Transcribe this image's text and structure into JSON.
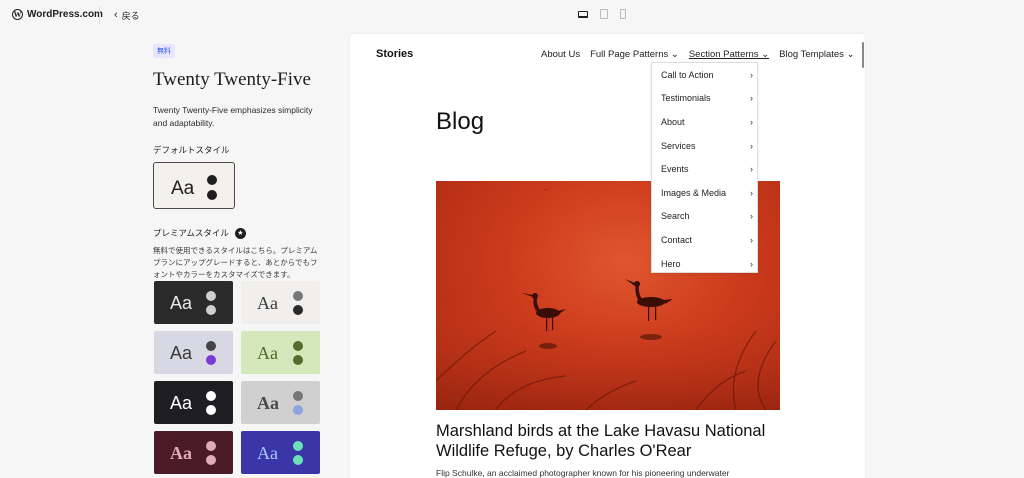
{
  "topbar": {
    "brand": "WordPress.com",
    "back_label": "戻る"
  },
  "sidebar": {
    "badge": "無料",
    "theme_title": "Twenty Twenty-Five",
    "theme_description": "Twenty Twenty-Five emphasizes simplicity and adaptability.",
    "default_style_label": "デフォルトスタイル",
    "default_style": {
      "sample": "Aa",
      "bg": "#f4f1ec",
      "fg": "#1e1e1e",
      "dot1": "#1e1e1e",
      "dot2": "#1e1e1e"
    },
    "premium_label": "プレミアムスタイル",
    "premium_description": "無料で使用できるスタイルはこちら。プレミアムプランにアップグレードすると、あとからでもフォントやカラーをカスタマイズできます。",
    "styles": [
      {
        "sample": "Aa",
        "bg": "#2a2a2a",
        "fg": "#e8e8e8",
        "dot1": "#d0d0d0",
        "dot2": "#d0d0d0",
        "font": "sans"
      },
      {
        "sample": "Aa",
        "bg": "#f0efee",
        "fg": "#3a3a3a",
        "dot1": "#777777",
        "dot2": "#2a2a2a",
        "font": "serif"
      },
      {
        "sample": "Aa",
        "bg": "#d8d8e4",
        "fg": "#3a3a3a",
        "dot1": "#444444",
        "dot2": "#7a3ad8",
        "font": "sans"
      },
      {
        "sample": "Aa",
        "bg": "#d4e8bc",
        "fg": "#4a6a26",
        "dot1": "#556b2f",
        "dot2": "#556b2f",
        "font": "serif"
      },
      {
        "sample": "Aa",
        "bg": "#1e1e22",
        "fg": "#ffffff",
        "dot1": "#ffffff",
        "dot2": "#ffffff",
        "font": "sans"
      },
      {
        "sample": "Aa",
        "bg": "#d0d0d0",
        "fg": "#4a4a4a",
        "dot1": "#777777",
        "dot2": "#8fa4e0",
        "font": "serif-bold"
      },
      {
        "sample": "Aa",
        "bg": "#4a1a26",
        "fg": "#e2a9b6",
        "dot1": "#e2a9b6",
        "dot2": "#e2a9b6",
        "font": "serif-bold"
      },
      {
        "sample": "Aa",
        "bg": "#3a36a8",
        "fg": "#a8c8ff",
        "dot1": "#6ee0b8",
        "dot2": "#6ee0b8",
        "font": "serif"
      }
    ]
  },
  "preview": {
    "site_title": "Stories",
    "nav": [
      {
        "label": "About Us"
      },
      {
        "label": "Full Page Patterns ⌄"
      },
      {
        "label": "Section Patterns ⌄"
      },
      {
        "label": "Blog Templates ⌄"
      }
    ],
    "blog_heading": "Blog",
    "post_title": "Marshland birds at the Lake Havasu National Wildlife Refuge, by Charles O'Rear",
    "post_excerpt": "Flip Schulke, an acclaimed photographer known for his pioneering underwater",
    "dropdown": [
      {
        "label": "Call to Action"
      },
      {
        "label": "Testimonials"
      },
      {
        "label": "About"
      },
      {
        "label": "Services"
      },
      {
        "label": "Events"
      },
      {
        "label": "Images & Media"
      },
      {
        "label": "Search"
      },
      {
        "label": "Contact"
      },
      {
        "label": "Hero"
      }
    ]
  }
}
